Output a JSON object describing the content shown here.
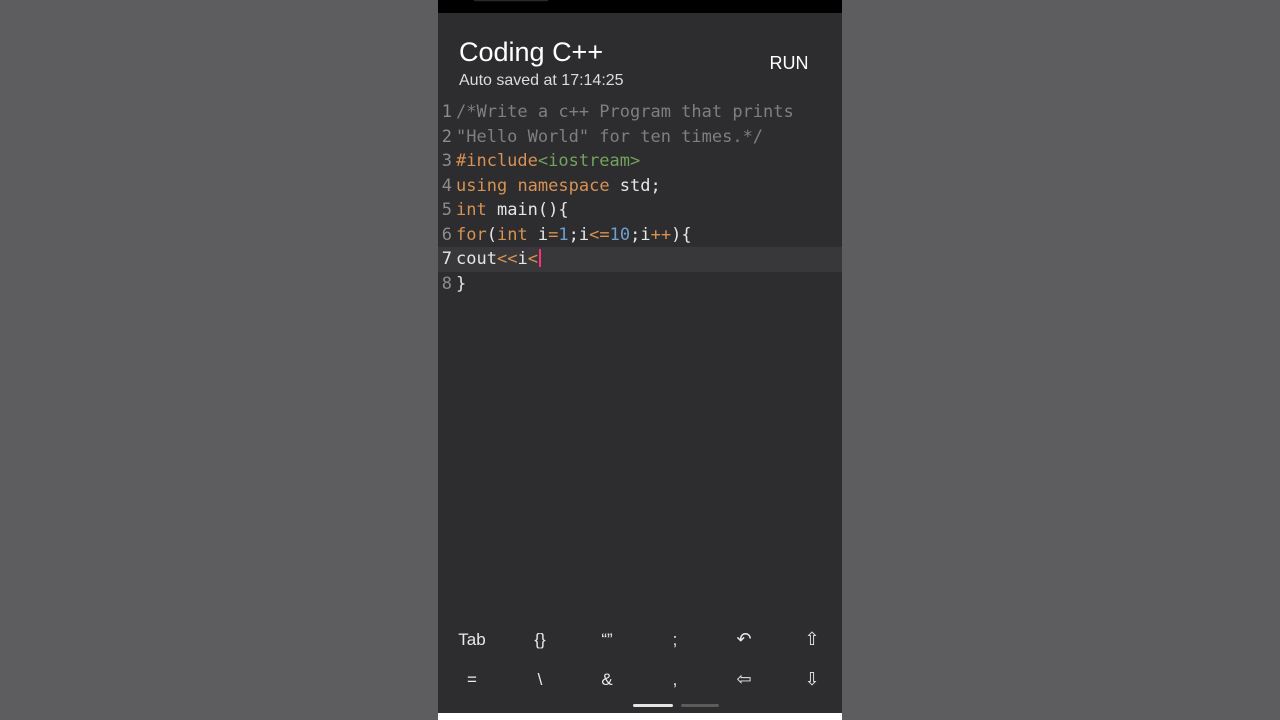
{
  "app": {
    "title": "Coding C++",
    "autosave_text": "Auto saved at 17:14:25",
    "run_label": "RUN"
  },
  "editor": {
    "current_line": "7",
    "cursor_after": "cout<<i<",
    "lines": [
      {
        "number": "1",
        "tokens": [
          {
            "text": "/*Write a c++ Program that prints",
            "kind": "comment"
          }
        ]
      },
      {
        "number": "2",
        "tokens": [
          {
            "text": "\"Hello World\" for ten times.*/",
            "kind": "comment"
          }
        ]
      },
      {
        "number": "3",
        "tokens": [
          {
            "text": "#include",
            "kind": "directive"
          },
          {
            "text": "<iostream>",
            "kind": "include-target"
          }
        ]
      },
      {
        "number": "4",
        "tokens": [
          {
            "text": "using",
            "kind": "keyword"
          },
          {
            "text": " ",
            "kind": "plain"
          },
          {
            "text": "namespace",
            "kind": "keyword"
          },
          {
            "text": " std;",
            "kind": "plain"
          }
        ]
      },
      {
        "number": "5",
        "tokens": [
          {
            "text": "int",
            "kind": "keyword"
          },
          {
            "text": " main(){",
            "kind": "plain"
          }
        ]
      },
      {
        "number": "6",
        "tokens": [
          {
            "text": "for",
            "kind": "keyword"
          },
          {
            "text": "(",
            "kind": "plain"
          },
          {
            "text": "int",
            "kind": "keyword"
          },
          {
            "text": " i",
            "kind": "plain"
          },
          {
            "text": "=",
            "kind": "operator"
          },
          {
            "text": "1",
            "kind": "number"
          },
          {
            "text": ";i",
            "kind": "plain"
          },
          {
            "text": "<=",
            "kind": "operator"
          },
          {
            "text": "10",
            "kind": "number"
          },
          {
            "text": ";i",
            "kind": "plain"
          },
          {
            "text": "++",
            "kind": "operator"
          },
          {
            "text": "){",
            "kind": "plain"
          }
        ]
      },
      {
        "number": "7",
        "tokens": [
          {
            "text": "cout",
            "kind": "plain"
          },
          {
            "text": "<<",
            "kind": "operator"
          },
          {
            "text": "i",
            "kind": "plain"
          },
          {
            "text": "<",
            "kind": "operator"
          }
        ]
      },
      {
        "number": "8",
        "tokens": [
          {
            "text": "}",
            "kind": "plain"
          }
        ]
      }
    ]
  },
  "keyboard": {
    "row1": [
      {
        "label": "Tab",
        "name": "tab-key",
        "icon": ""
      },
      {
        "label": "{}",
        "name": "braces-key",
        "icon": ""
      },
      {
        "label": "“”",
        "name": "quotes-key",
        "icon": ""
      },
      {
        "label": ";",
        "name": "semicolon-key",
        "icon": ""
      },
      {
        "label": "↶",
        "name": "undo-key",
        "icon": "undo-icon"
      },
      {
        "label": "⇧",
        "name": "shift-up-key",
        "icon": "up-arrow-icon"
      }
    ],
    "row2": [
      {
        "label": "=",
        "name": "equals-key",
        "icon": ""
      },
      {
        "label": "\\",
        "name": "backslash-key",
        "icon": ""
      },
      {
        "label": "&",
        "name": "ampersand-key",
        "icon": ""
      },
      {
        "label": ",",
        "name": "comma-key",
        "icon": ""
      },
      {
        "label": "⇦",
        "name": "left-arrow-key",
        "icon": "left-arrow-icon"
      },
      {
        "label": "⇩",
        "name": "down-arrow-key",
        "icon": "down-arrow-icon"
      }
    ]
  },
  "colors": {
    "background": "#5d5d5f",
    "surface": "#2d2c2f",
    "current_line": "#38373a",
    "comment": "#7f7f7f",
    "keyword": "#d79254",
    "include_target": "#73a35c",
    "number": "#6f9ed1",
    "cursor": "#ff2f79"
  }
}
